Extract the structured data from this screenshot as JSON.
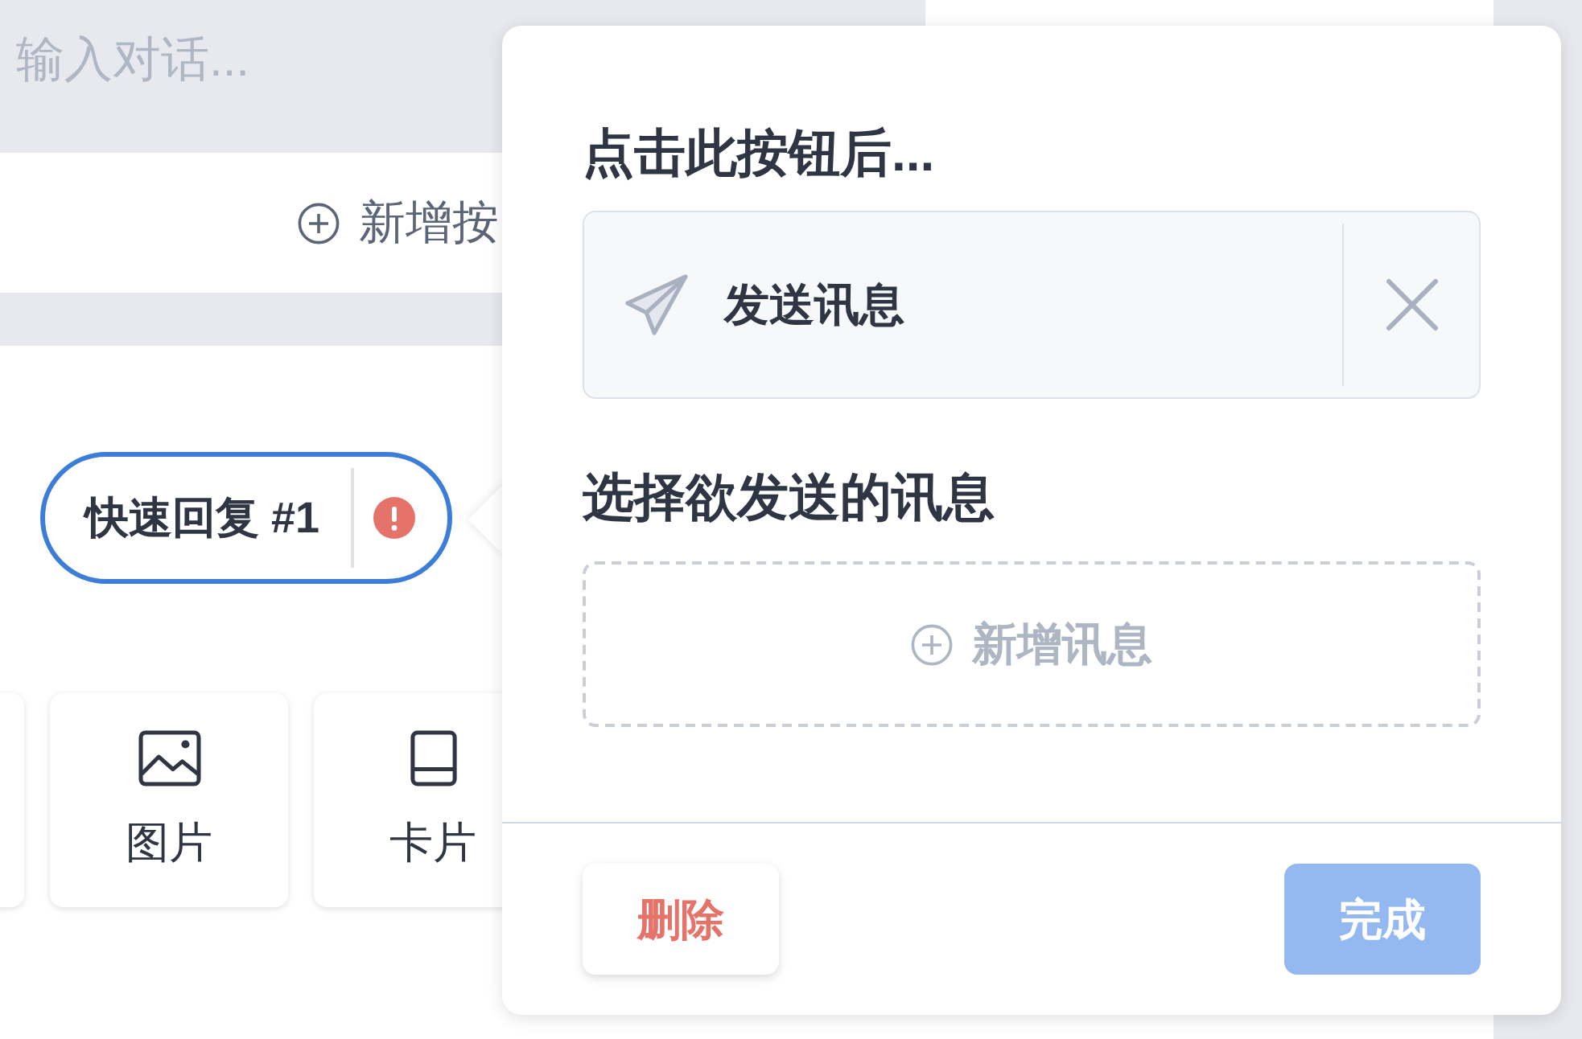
{
  "message_input": {
    "placeholder": "输入对话..."
  },
  "add_button": {
    "label": "新增按"
  },
  "quick_reply": {
    "label": "快速回复 #1",
    "selected": true,
    "error": true
  },
  "message_types": [
    {
      "kind": "image",
      "label": "图片"
    },
    {
      "kind": "card",
      "label": "卡片"
    }
  ],
  "popup": {
    "trigger_title": "点击此按钮后...",
    "action": {
      "kind": "send",
      "label": "发送讯息"
    },
    "message_title": "选择欲发送的讯息",
    "add_message": {
      "label": "新增讯息"
    },
    "delete_button": {
      "label": "删除"
    },
    "done_button": {
      "label": "完成",
      "disabled": true
    }
  }
}
